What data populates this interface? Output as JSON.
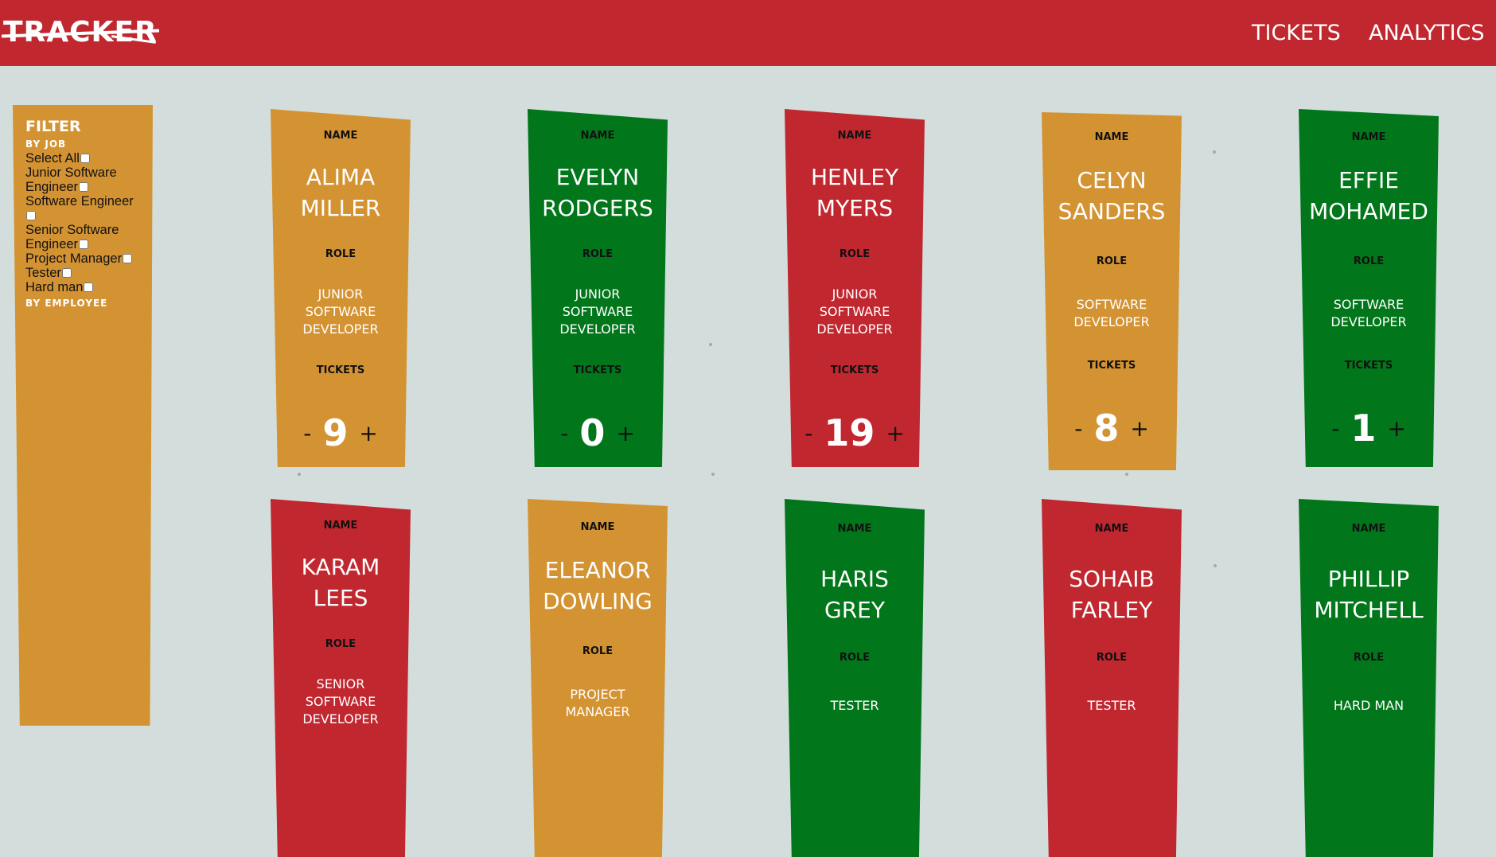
{
  "header": {
    "logo": "TRACKER",
    "nav": [
      "TICKETS",
      "ANALYTICS"
    ]
  },
  "filter": {
    "title": "FILTER",
    "by_job": "BY JOB",
    "options": [
      "Select All",
      "Junior Software Engineer",
      "Software Engineer",
      "Senior Software Engineer",
      "Project Manager",
      "Tester",
      "Hard man"
    ],
    "by_employee": "BY EMPLOYEE"
  },
  "card_labels": {
    "name": "NAME",
    "role": "ROLE",
    "tickets": "TICKETS",
    "minus": "-",
    "plus": "+"
  },
  "colors": {
    "header": "#c1272f",
    "orange": "#d49333",
    "green": "#02761b",
    "red": "#c1272f",
    "background": "#d3dedc"
  },
  "employees": [
    {
      "first": "ALIMA",
      "last": "MILLER",
      "role": [
        "JUNIOR",
        "SOFTWARE",
        "DEVELOPER"
      ],
      "tickets": "9",
      "color": "#d49333"
    },
    {
      "first": "EVELYN",
      "last": "RODGERS",
      "role": [
        "JUNIOR",
        "SOFTWARE",
        "DEVELOPER"
      ],
      "tickets": "0",
      "color": "#02761b"
    },
    {
      "first": "HENLEY",
      "last": "MYERS",
      "role": [
        "JUNIOR",
        "SOFTWARE",
        "DEVELOPER"
      ],
      "tickets": "19",
      "color": "#c1272f"
    },
    {
      "first": "CELYN",
      "last": "SANDERS",
      "role": [
        "SOFTWARE",
        "DEVELOPER"
      ],
      "tickets": "8",
      "color": "#d49333"
    },
    {
      "first": "EFFIE",
      "last": "MOHAMED",
      "role": [
        "SOFTWARE",
        "DEVELOPER"
      ],
      "tickets": "1",
      "color": "#02761b"
    },
    {
      "first": "KARAM",
      "last": "LEES",
      "role": [
        "SENIOR",
        "SOFTWARE",
        "DEVELOPER"
      ],
      "tickets": "",
      "color": "#c1272f"
    },
    {
      "first": "ELEANOR",
      "last": "DOWLING",
      "role": [
        "PROJECT",
        "MANAGER"
      ],
      "tickets": "",
      "color": "#d49333"
    },
    {
      "first": "HARIS",
      "last": "GREY",
      "role": [
        "TESTER"
      ],
      "tickets": "",
      "color": "#02761b"
    },
    {
      "first": "SOHAIB",
      "last": "FARLEY",
      "role": [
        "TESTER"
      ],
      "tickets": "",
      "color": "#c1272f"
    },
    {
      "first": "PHILLIP",
      "last": "MITCHELL",
      "role": [
        "HARD MAN"
      ],
      "tickets": "",
      "color": "#02761b"
    }
  ]
}
